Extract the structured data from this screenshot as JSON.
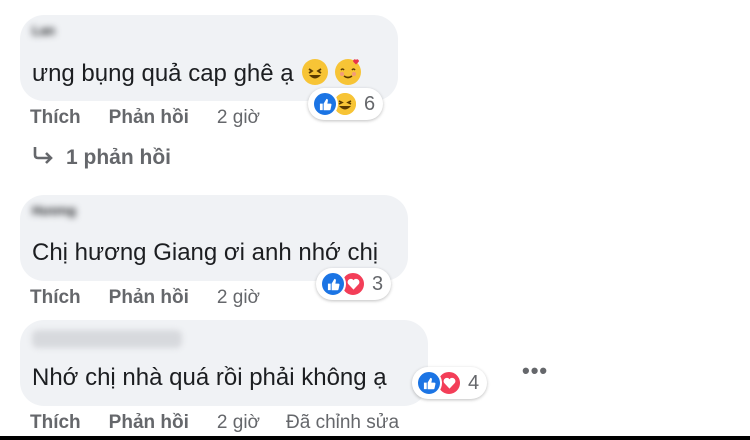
{
  "comments": [
    {
      "author": "Lan",
      "text": "ưng bụng quả cap ghê ạ",
      "reaction_count": "6",
      "actions": {
        "like": "Thích",
        "reply": "Phản hồi",
        "time": "2 giờ",
        "edited": ""
      }
    },
    {
      "author": "Hương",
      "text": "Chị hương Giang ơi anh nhớ chị",
      "reaction_count": "3",
      "actions": {
        "like": "Thích",
        "reply": "Phản hồi",
        "time": "2 giờ",
        "edited": ""
      }
    },
    {
      "author": "",
      "text": "Nhớ chị nhà quá rồi phải không ạ",
      "reaction_count": "4",
      "actions": {
        "like": "Thích",
        "reply": "Phản hồi",
        "time": "2 giờ",
        "edited": "Đã chỉnh sửa"
      }
    }
  ],
  "replies_link": "1 phản hồi",
  "more_menu": "•••",
  "colors": {
    "like": "#1b74e4",
    "love": "#f33e58",
    "haha": "#f7c436",
    "bubble": "#f0f2f5",
    "muted": "#65676b"
  }
}
